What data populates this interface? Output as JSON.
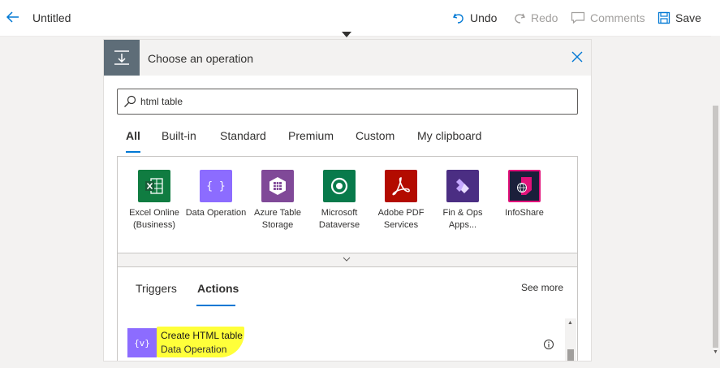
{
  "topbar": {
    "title": "Untitled",
    "undo_label": "Undo",
    "redo_label": "Redo",
    "comments_label": "Comments",
    "save_label": "Save"
  },
  "panel": {
    "title": "Choose an operation",
    "search": {
      "value": "html table",
      "icon": "search-icon"
    },
    "category_tabs": [
      {
        "label": "All",
        "active": true
      },
      {
        "label": "Built-in"
      },
      {
        "label": "Standard"
      },
      {
        "label": "Premium"
      },
      {
        "label": "Custom"
      },
      {
        "label": "My clipboard"
      }
    ],
    "connectors": [
      {
        "label": "Excel Online (Business)",
        "color": "#107c41",
        "icon": "excel-icon"
      },
      {
        "label": "Data Operation",
        "color": "#8c6cff",
        "icon": "data-operation-icon"
      },
      {
        "label": "Azure Table Storage",
        "color": "#804998",
        "icon": "azure-table-icon"
      },
      {
        "label": "Microsoft Dataverse",
        "color": "#087a4b",
        "icon": "dataverse-icon"
      },
      {
        "label": "Adobe PDF Services",
        "color": "#b30b00",
        "icon": "adobe-pdf-icon"
      },
      {
        "label": "Fin & Ops Apps...",
        "color": "#4b2e83",
        "icon": "fin-ops-icon"
      },
      {
        "label": "InfoShare",
        "color": "#1b1f3b",
        "icon": "infoshare-icon"
      }
    ],
    "action_tabs": [
      {
        "label": "Triggers"
      },
      {
        "label": "Actions",
        "active": true
      }
    ],
    "see_more": "See more",
    "actions": [
      {
        "title": "Create HTML table",
        "subtitle": "Data Operation",
        "highlight_color": "#ffff3a"
      }
    ]
  },
  "colors": {
    "accent": "#0078d4"
  }
}
